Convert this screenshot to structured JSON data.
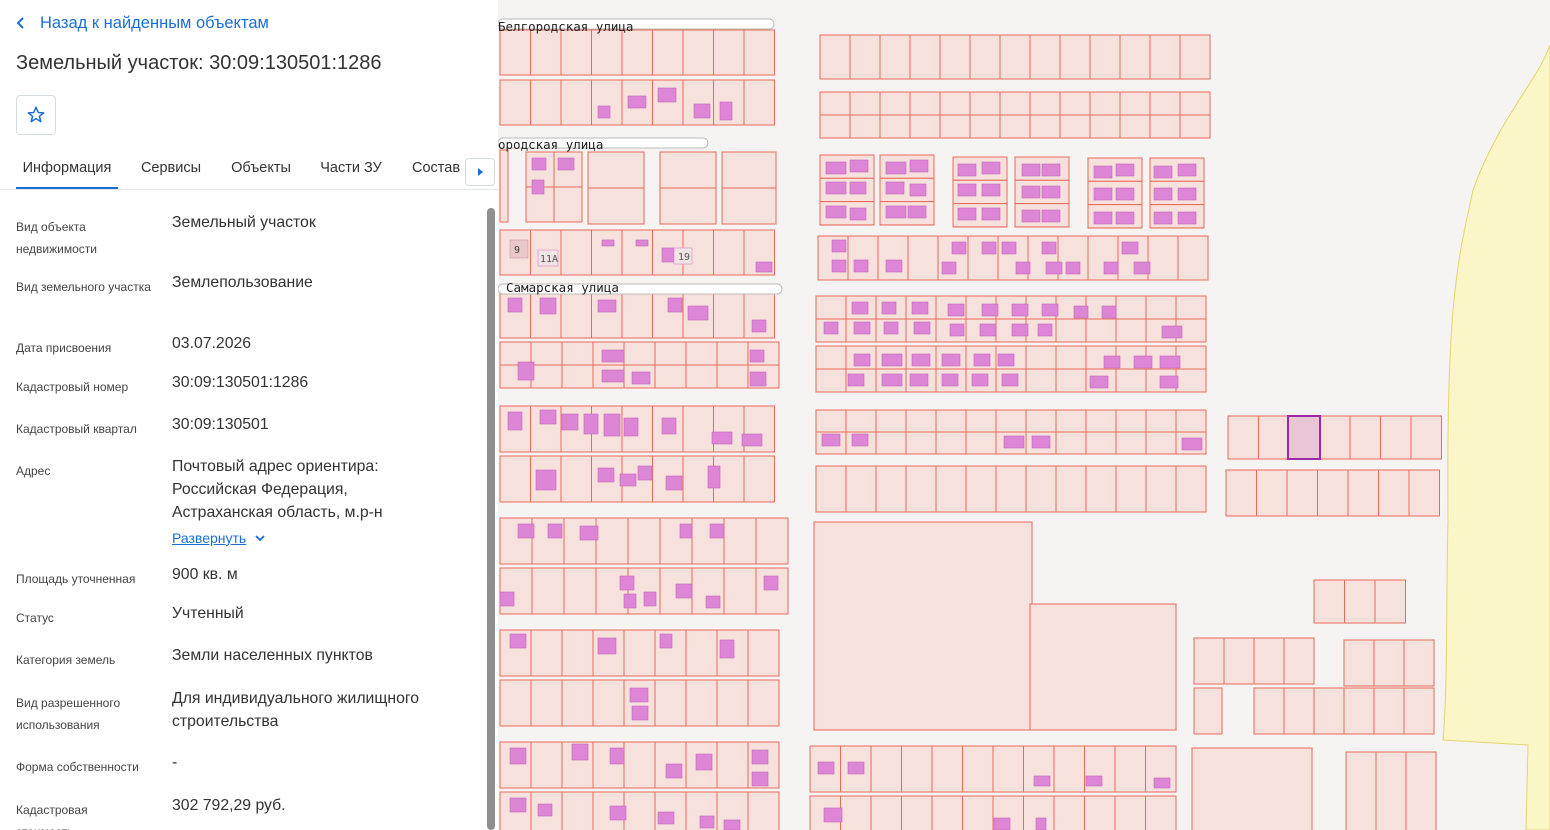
{
  "panel": {
    "back_label": "Назад к найденным объектам",
    "title": "Земельный участок: 30:09:130501:1286",
    "tabs": [
      "Информация",
      "Сервисы",
      "Объекты",
      "Части ЗУ",
      "Состав"
    ],
    "rows": [
      {
        "label": "Вид объекта недвижимости",
        "value": "Земельный участок"
      },
      {
        "label": "Вид земельного участка",
        "value": "Землепользование"
      },
      {
        "label": "Дата присвоения",
        "value": "03.07.2026"
      },
      {
        "label": "Кадастровый номер",
        "value": "30:09:130501:1286"
      },
      {
        "label": "Кадастровый квартал",
        "value": "30:09:130501"
      },
      {
        "label": "Адрес",
        "value": "Почтовый адрес ориентира: Российская Федерация, Астраханская область, м.р-н"
      },
      {
        "label": "Площадь уточненная",
        "value": "900 кв. м"
      },
      {
        "label": "Статус",
        "value": "Учтенный"
      },
      {
        "label": "Категория земель",
        "value": "Земли населенных пунктов"
      },
      {
        "label": "Вид разрешенного использования",
        "value": "Для индивидуального жилищного строительства"
      },
      {
        "label": "Форма собственности",
        "value": "-"
      },
      {
        "label": "Кадастровая стоимость",
        "value": "302 792,29 руб."
      }
    ],
    "expand_label": "Развернуть"
  },
  "map": {
    "streets": [
      "Белгородская улица",
      "ородская улица",
      "Самарская улица"
    ],
    "house_numbers": [
      "9",
      "11А",
      "19"
    ],
    "colors": {
      "parcel_fill": "#f7e1dd",
      "parcel_stroke": "#e86b58",
      "building": "#de86d6",
      "selected": "#9c2aa8",
      "zone": "#fbf6c8"
    }
  }
}
